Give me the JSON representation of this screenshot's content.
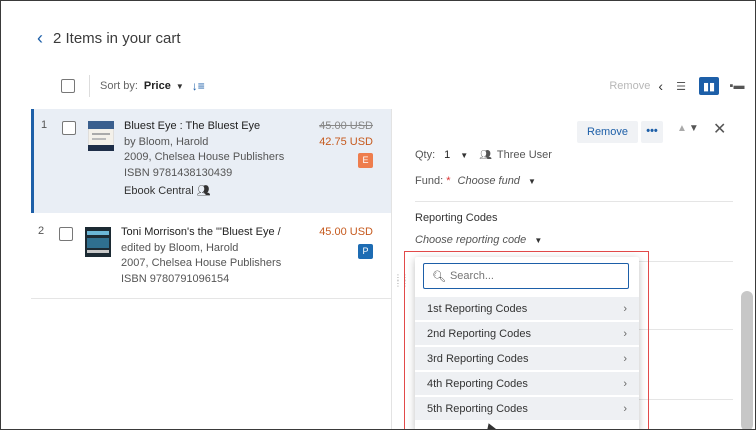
{
  "header": {
    "title": "2 Items in your cart"
  },
  "toolbar": {
    "sort_label": "Sort by:",
    "sort_value": "Price",
    "remove_label": "Remove"
  },
  "items": [
    {
      "index": "1",
      "title": "Bluest Eye : The Bluest Eye",
      "author": "by Bloom, Harold",
      "pub": "2009, Chelsea House Publishers",
      "isbn": "ISBN 9781438130439",
      "extra": "Ebook Central",
      "old_price": "45.00 USD",
      "price": "42.75 USD",
      "badge": "E"
    },
    {
      "index": "2",
      "title": "Toni Morrison's the \"'Bluest Eye /",
      "author": "edited by Bloom, Harold",
      "pub": "2007, Chelsea House Publishers",
      "isbn": "ISBN 9780791096154",
      "price": "45.00 USD",
      "badge": "P"
    }
  ],
  "detail": {
    "remove_label": "Remove",
    "more_label": "•••",
    "qty_label": "Qty:",
    "qty_value": "1",
    "user_label": "Three User",
    "fund_label": "Fund:",
    "fund_required": "*",
    "fund_placeholder": "Choose fund",
    "reporting_label": "Reporting Codes",
    "reporting_placeholder": "Choose reporting code"
  },
  "dropdown": {
    "search_placeholder": "Search...",
    "items": [
      "1st Reporting Codes",
      "2nd Reporting Codes",
      "3rd Reporting Codes",
      "4th Reporting Codes",
      "5th Reporting Codes"
    ]
  },
  "colors": {
    "accent": "#1d5fa8",
    "price": "#c65a1e",
    "badge_e": "#ee7d4d",
    "badge_p": "#1d6cb3",
    "highlight": "#e24a4a"
  }
}
